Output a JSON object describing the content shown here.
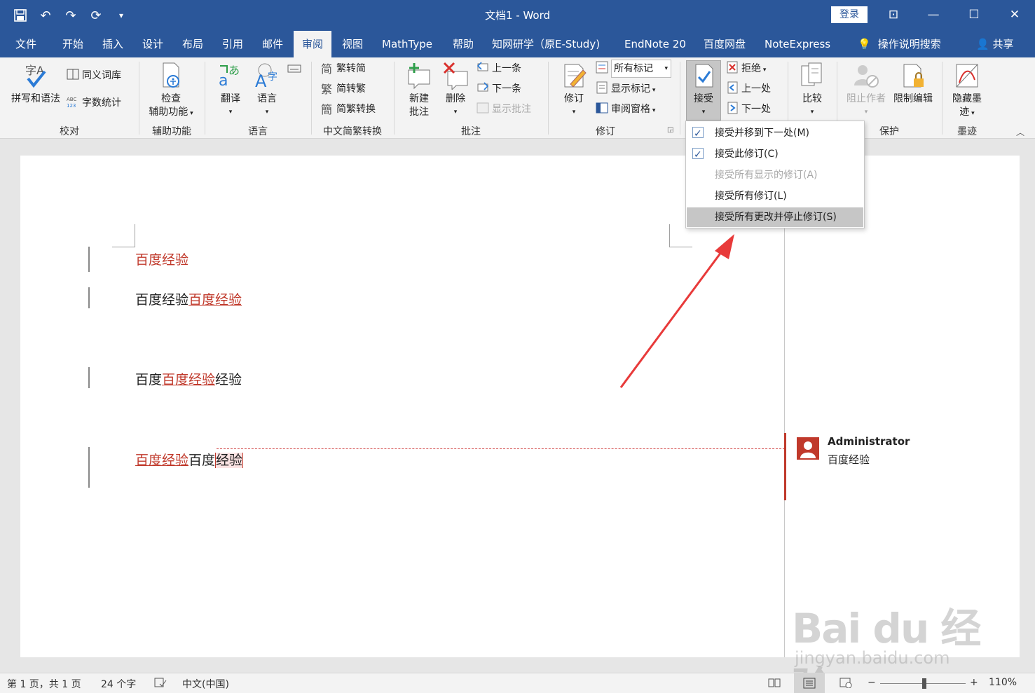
{
  "window": {
    "title": "文档1  -  Word",
    "login": "登录"
  },
  "tabs": [
    "文件",
    "开始",
    "插入",
    "设计",
    "布局",
    "引用",
    "邮件",
    "审阅",
    "视图",
    "MathType",
    "帮助",
    "知网研学（原E-Study)",
    "EndNote 20",
    "百度网盘",
    "NoteExpress",
    "操作说明搜索"
  ],
  "active_tab": "审阅",
  "share": "共享",
  "ribbon": {
    "groups": {
      "proofing": "校对",
      "accessibility": "辅助功能",
      "language": "语言",
      "chinese_convert": "中文简繁转换",
      "comments": "批注",
      "tracking": "修订",
      "protect": "保护",
      "ink": "墨迹"
    },
    "spelling": "拼写和语法",
    "thesaurus": "同义词库",
    "word_count": "字数统计",
    "check_access_1": "检查",
    "check_access_2": "辅助功能",
    "translate": "翻译",
    "language": "语言",
    "to_simplified": "繁转简",
    "to_traditional": "简转繁",
    "convert": "简繁转换",
    "new_comment_1": "新建",
    "new_comment_2": "批注",
    "delete": "删除",
    "prev_comment": "上一条",
    "next_comment": "下一条",
    "show_comments": "显示批注",
    "track_changes": "修订",
    "markup_select": "所有标记",
    "show_markup": "显示标记",
    "reviewing_pane": "审阅窗格",
    "accept": "接受",
    "reject": "拒绝",
    "prev_change": "上一处",
    "next_change": "下一处",
    "compare": "比较",
    "block_authors": "阻止作者",
    "restrict_editing": "限制编辑",
    "hide_ink_1": "隐藏墨",
    "hide_ink_2": "迹"
  },
  "dropdown": {
    "items": [
      {
        "label": "接受并移到下一处(M)",
        "checked": true,
        "disabled": false
      },
      {
        "label": "接受此修订(C)",
        "checked": true,
        "disabled": false
      },
      {
        "label": "接受所有显示的修订(A)",
        "checked": false,
        "disabled": true
      },
      {
        "label": "接受所有修订(L)",
        "checked": false,
        "disabled": false
      },
      {
        "label": "接受所有更改并停止修订(S)",
        "checked": false,
        "disabled": false
      }
    ]
  },
  "document": {
    "p1_deleted": "百度经验",
    "p2_normal": "百度经验",
    "p2_inserted": "百度经验",
    "p3_before": "百度",
    "p3_inserted": "百度经验",
    "p3_after": "经验",
    "p4_inserted": "百度经验",
    "p4_normal": "百度",
    "p4_commented": "经验"
  },
  "comment": {
    "author": "Administrator",
    "text": "百度经验"
  },
  "status": {
    "page": "第 1 页，共 1 页",
    "words": "24 个字",
    "language": "中文(中国)",
    "zoom": "110%"
  },
  "watermark": {
    "brand": "Bai du 经验",
    "url": "jingyan.baidu.com"
  },
  "colors": {
    "brand_blue": "#2b579a",
    "revision_red": "#c0392b",
    "annotation_arrow": "#e83a3a"
  }
}
